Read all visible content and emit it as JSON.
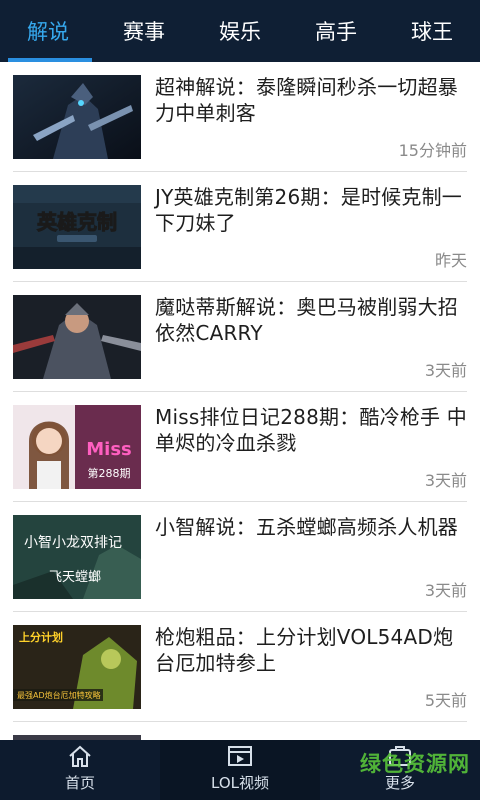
{
  "top_tabs": [
    {
      "label": "解说",
      "active": true
    },
    {
      "label": "赛事",
      "active": false
    },
    {
      "label": "娱乐",
      "active": false
    },
    {
      "label": "高手",
      "active": false
    },
    {
      "label": "球王",
      "active": false
    }
  ],
  "videos": [
    {
      "title": "超神解说：泰隆瞬间秒杀一切超暴力中单刺客",
      "time": "15分钟前"
    },
    {
      "title": "JY英雄克制第26期：是时候克制一下刀妹了",
      "time": "昨天",
      "thumb_text": "英雄克制"
    },
    {
      "title": "魔哒蒂斯解说：奥巴马被削弱大招依然CARRY",
      "time": "3天前"
    },
    {
      "title": "Miss排位日记288期：酷冷枪手 中单烬的冷血杀戮",
      "time": "3天前",
      "thumb_text": "Miss",
      "thumb_sub": "第288期"
    },
    {
      "title": "小智解说：五杀螳螂高频杀人机器",
      "time": "3天前",
      "thumb_text": "小智小龙双排记",
      "thumb_sub": "飞天螳螂"
    },
    {
      "title": "枪炮粗品：上分计划VOL54AD炮台厄加特参上",
      "time": "5天前",
      "thumb_text": "上分计划",
      "thumb_sub": "最强AD炮台厄加特攻略"
    }
  ],
  "bottom_nav": [
    {
      "label": "首页",
      "icon": "home-icon",
      "active": false
    },
    {
      "label": "LOL视频",
      "icon": "video-icon",
      "active": true
    },
    {
      "label": "更多",
      "icon": "more-icon",
      "active": false
    }
  ],
  "watermark": "绿色资源网",
  "colors": {
    "topbar": "#0f1f34",
    "active_tab": "#36a9ee",
    "bottombar": "#0d1b2e",
    "watermark": "#58c43a"
  }
}
